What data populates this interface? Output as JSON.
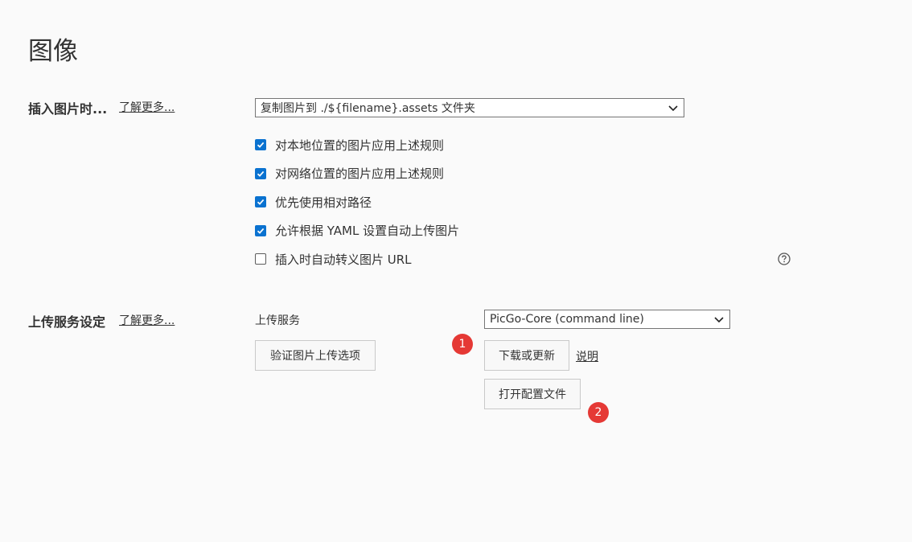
{
  "page": {
    "title": "图像"
  },
  "insert_section": {
    "label": "插入图片时...",
    "learn_more": "了解更多...",
    "action_select": {
      "value": "复制图片到 ./${filename}.assets 文件夹"
    },
    "options": [
      {
        "label": "对本地位置的图片应用上述规则",
        "checked": true
      },
      {
        "label": "对网络位置的图片应用上述规则",
        "checked": true
      },
      {
        "label": "优先使用相对路径",
        "checked": true
      },
      {
        "label": "允许根据 YAML 设置自动上传图片",
        "checked": true
      },
      {
        "label": "插入时自动转义图片 URL",
        "checked": false
      }
    ],
    "help_icon": "question-circle-icon"
  },
  "upload_section": {
    "label": "上传服务设定",
    "learn_more": "了解更多...",
    "service_label": "上传服务",
    "service_select": {
      "value": "PicGo-Core (command line)"
    },
    "validate_button": "验证图片上传选项",
    "download_button": "下载或更新",
    "explain_link": "说明",
    "open_config_button": "打开配置文件",
    "badges": [
      "1",
      "2"
    ]
  },
  "colors": {
    "checkbox_on": "#0a72d0",
    "badge": "#e53935",
    "background": "#fafafa"
  }
}
